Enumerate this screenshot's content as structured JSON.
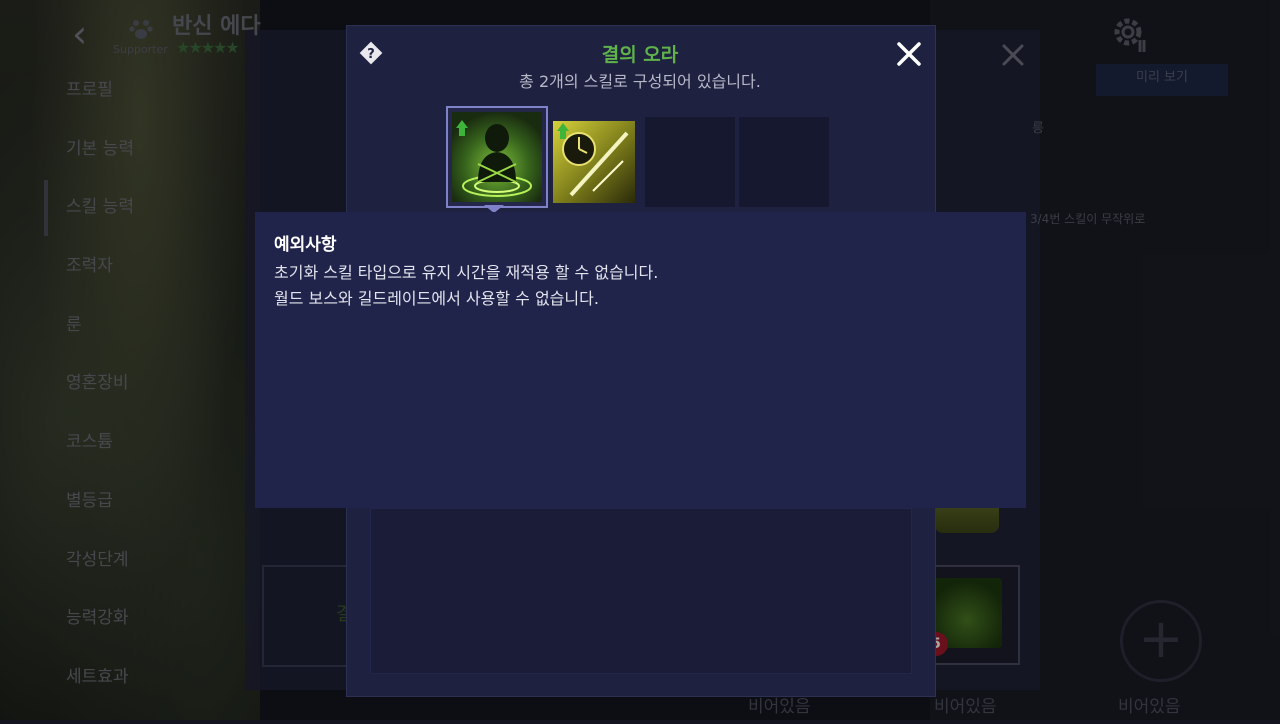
{
  "background": {
    "character": {
      "name": "반신 에다",
      "role": "Supporter",
      "stars": "★★★★★"
    },
    "side_menu": [
      "프로필",
      "기본 능력",
      "스킬 능력",
      "조력자",
      "룬",
      "영혼장비",
      "코스튬",
      "별등급",
      "각성단계",
      "능력강화",
      "세트효과"
    ],
    "preview_button": "미리 보기",
    "note1": "릉",
    "note2": "3/4번 스킬이 무작위로",
    "slot_label": "결",
    "empty_labels": [
      "비어있음",
      "비어있음",
      "비어있음"
    ],
    "badge": "5"
  },
  "modal": {
    "title": "결의 오라",
    "subtitle": "총 2개의 스킬로 구성되어 있습니다.",
    "colors": {
      "title": "#5fb34a",
      "panel": "#1e2140",
      "tooltip": "#20234a"
    }
  },
  "tooltip": {
    "heading": "예외사항",
    "lines": [
      "초기화 스킬 타입으로 유지 시간을 재적용 할 수 없습니다.",
      "월드 보스와 길드레이드에서 사용할 수 없습니다."
    ]
  }
}
